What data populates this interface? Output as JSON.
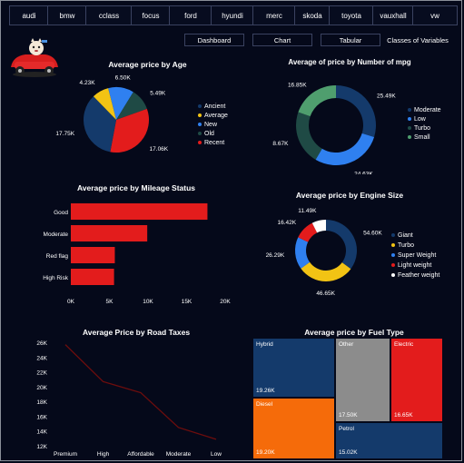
{
  "brands": [
    "audi",
    "bmw",
    "cclass",
    "focus",
    "ford",
    "hyundi",
    "merc",
    "skoda",
    "toyota",
    "vauxhall",
    "vw"
  ],
  "nav": {
    "dashboard": "Dashboard",
    "chart": "Chart",
    "tabular": "Tabular",
    "classes": "Classes of Variables"
  },
  "colors": {
    "navy": "#143a6b",
    "yellow": "#f2c314",
    "blue": "#2f80f0",
    "darkgreen": "#1f4a45",
    "red": "#e31c1c",
    "green": "#4f9e6e",
    "white": "#ffffff",
    "gray": "#8c8c8c",
    "orange": "#f56b0a",
    "line": "#6e0d0d"
  },
  "chart_data": [
    {
      "id": "age",
      "type": "pie",
      "title": "Average price by Age",
      "categories": [
        "Ancient",
        "Average",
        "New",
        "Old",
        "Recent"
      ],
      "values": [
        17.75,
        4.23,
        6.5,
        5.49,
        17.06
      ],
      "labels": [
        "17.75K",
        "4.23K",
        "6.50K",
        "5.49K",
        "17.06K"
      ]
    },
    {
      "id": "mpg",
      "type": "pie",
      "title": "Average of price by Number of mpg",
      "categories": [
        "Moderate",
        "Low",
        "Turbo",
        "Small"
      ],
      "values": [
        25.49,
        24.63,
        18.67,
        16.85
      ],
      "labels": [
        "25.49K",
        "24.63K",
        "18.67K",
        "16.85K"
      ]
    },
    {
      "id": "mileage",
      "type": "bar",
      "title": "Average price by Mileage Status",
      "categories": [
        "Good",
        "Moderate",
        "Red flag",
        "High Risk"
      ],
      "values": [
        17.7,
        9.9,
        5.7,
        5.6
      ],
      "xticks": [
        "0K",
        "5K",
        "10K",
        "15K",
        "20K"
      ],
      "xlim": [
        0,
        20
      ]
    },
    {
      "id": "engine",
      "type": "pie",
      "title": "Average price by Engine Size",
      "categories": [
        "Giant",
        "Turbo",
        "Super Weight",
        "Light weight",
        "Feather weight"
      ],
      "values": [
        54.6,
        46.65,
        26.29,
        16.42,
        11.49
      ],
      "labels": [
        "54.60K",
        "46.65K",
        "26.29K",
        "16.42K",
        "11.49K"
      ]
    },
    {
      "id": "tax",
      "type": "line",
      "title": "Average Price by Road Taxes",
      "categories": [
        "Premium",
        "High",
        "Affordable",
        "Moderate",
        "Low"
      ],
      "values": [
        25.8,
        20.8,
        19.3,
        14.6,
        13.0
      ],
      "yticks": [
        "26K",
        "24K",
        "22K",
        "20K",
        "18K",
        "16K",
        "14K",
        "12K"
      ],
      "ylim": [
        12,
        26
      ]
    },
    {
      "id": "fuel",
      "type": "treemap",
      "title": "Average price by Fuel Type",
      "categories": [
        "Hybrid",
        "Diesel",
        "Other",
        "Electric",
        "Petrol"
      ],
      "values": [
        19.26,
        19.2,
        17.5,
        16.65,
        15.02
      ],
      "labels": [
        "19.26K",
        "19.20K",
        "17.50K",
        "16.65K",
        "15.02K"
      ]
    }
  ]
}
